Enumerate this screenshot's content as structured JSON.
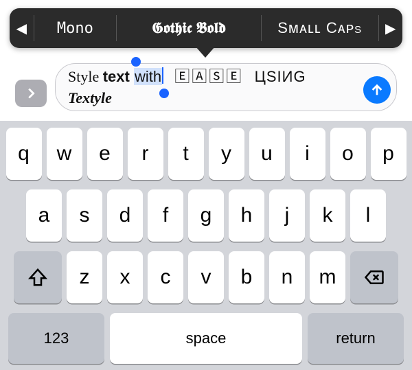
{
  "picker": {
    "prev_icon": "◀",
    "next_icon": "▶",
    "options": [
      "Mono",
      "𝕲𝖔𝖙𝖍𝖎𝖈 𝕭𝖔𝖑𝖉",
      "Sᴍᴀʟʟ Cᴀᴘs"
    ]
  },
  "compose": {
    "word_plain": "Style ",
    "word_bold": "text",
    "word_selected": "with",
    "word_ease": " 🄴🄰🅂🄴 ",
    "word_cyr": "ЦSIИG",
    "word_brand": "Textyle"
  },
  "keyboard": {
    "row1": [
      "q",
      "w",
      "e",
      "r",
      "t",
      "y",
      "u",
      "i",
      "o",
      "p"
    ],
    "row2": [
      "a",
      "s",
      "d",
      "f",
      "g",
      "h",
      "j",
      "k",
      "l"
    ],
    "row3": [
      "z",
      "x",
      "c",
      "v",
      "b",
      "n",
      "m"
    ],
    "numbers_label": "123",
    "space_label": "space",
    "return_label": "return"
  }
}
